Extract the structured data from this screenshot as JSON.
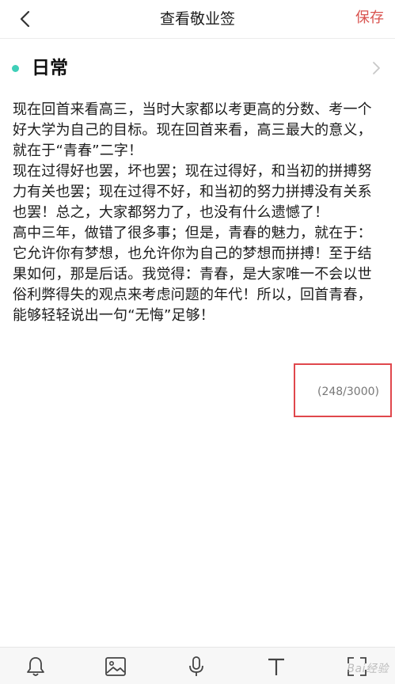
{
  "header": {
    "title": "查看敬业签",
    "save_label": "保存",
    "back_icon": "chevron-left-icon"
  },
  "category": {
    "label": "日常",
    "dot_color": "#3fcfb8"
  },
  "note": {
    "paragraphs": [
      "现在回首来看高三，当时大家都以考更高的分数、考一个好大学为自己的目标。现在回首来看，高三最大的意义，就在于“青春”二字！",
      "现在过得好也罢，坏也罢；现在过得好，和当初的拼搏努力有关也罢；现在过得不好，和当初的努力拼搏没有关系也罢！总之，大家都努力了，也没有什么遗憾了！",
      "高中三年，做错了很多事；但是，青春的魅力，就在于：它允许你有梦想，也允许你为自己的梦想而拼搏！至于结果如何，那是后话。我觉得：青春，是大家唯一不会以世俗利弊得失的观点来考虑问题的年代！所以，回首青春，能够轻轻说出一句“无悔”足够！"
    ],
    "char_count": "(248/3000)"
  },
  "toolbar": {
    "items": [
      "bell-icon",
      "image-icon",
      "microphone-icon",
      "text-format-icon",
      "fullscreen-icon"
    ]
  },
  "accent_color": "#d9534f"
}
